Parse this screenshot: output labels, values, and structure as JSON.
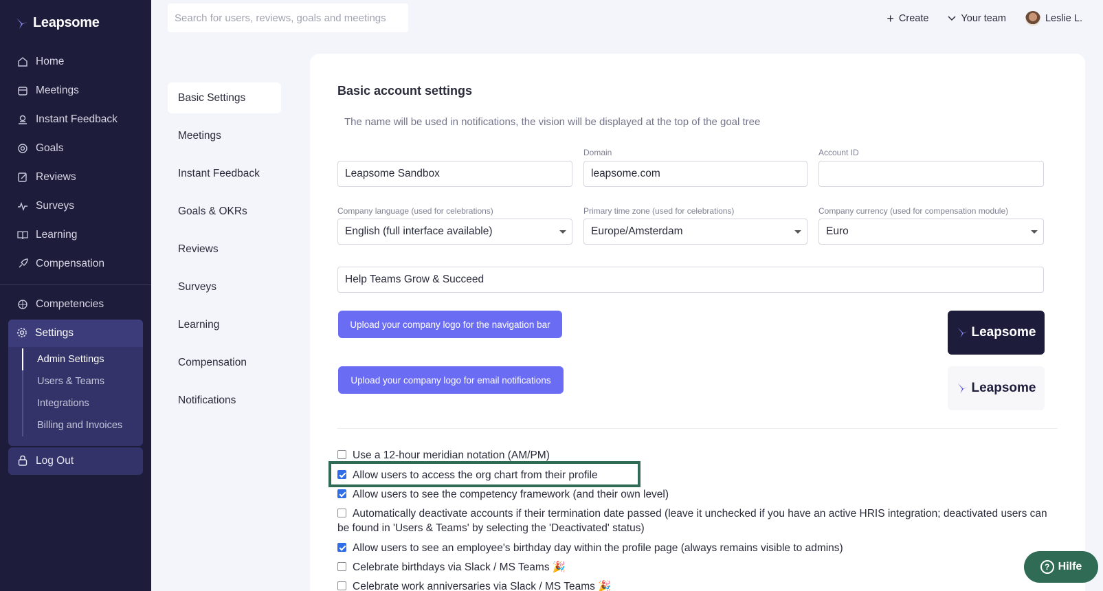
{
  "app": {
    "brand": "Leapsome",
    "accent": "#6b6cf4",
    "sidebar_bg": "#1d1c3b",
    "highlight_color": "#2f6b55"
  },
  "sidebar": {
    "items": [
      {
        "label": "Home",
        "icon": "home-icon"
      },
      {
        "label": "Meetings",
        "icon": "calendar-icon"
      },
      {
        "label": "Instant Feedback",
        "icon": "feedback-icon"
      },
      {
        "label": "Goals",
        "icon": "target-icon"
      },
      {
        "label": "Reviews",
        "icon": "review-icon"
      },
      {
        "label": "Surveys",
        "icon": "pulse-icon"
      },
      {
        "label": "Learning",
        "icon": "book-icon"
      },
      {
        "label": "Compensation",
        "icon": "rocket-icon"
      }
    ],
    "competencies": "Competencies",
    "settings": "Settings",
    "settings_sub": [
      "Admin Settings",
      "Users & Teams",
      "Integrations",
      "Billing and Invoices"
    ],
    "logout": "Log Out"
  },
  "topbar": {
    "search_placeholder": "Search for users, reviews, goals and meetings",
    "create": "Create",
    "your_team": "Your team",
    "user": "Leslie L."
  },
  "settings_menu": [
    "Basic Settings",
    "Meetings",
    "Instant Feedback",
    "Goals & OKRs",
    "Reviews",
    "Surveys",
    "Learning",
    "Compensation",
    "Notifications"
  ],
  "card": {
    "title": "Basic account settings",
    "description": "The name will be used in notifications, the vision will be displayed at the top of the goal tree",
    "company_name": "Leapsome Sandbox",
    "domain_label": "Domain",
    "domain": "leapsome.com",
    "account_id_label": "Account ID",
    "account_id": "",
    "language_label": "Company language (used for celebrations)",
    "language": "English (full interface available)",
    "timezone_label": "Primary time zone (used for celebrations)",
    "timezone": "Europe/Amsterdam",
    "currency_label": "Company currency (used for compensation module)",
    "currency": "Euro",
    "vision": "Help Teams Grow & Succeed",
    "upload_nav_logo": "Upload your company logo for the navigation bar",
    "upload_email_logo": "Upload your company logo for email notifications",
    "checkboxes": [
      {
        "label": "Use a 12-hour meridian notation (AM/PM)",
        "checked": false
      },
      {
        "label": "Allow users to access the org chart from their profile",
        "checked": true
      },
      {
        "label": "Allow users to see the competency framework (and their own level)",
        "checked": true
      },
      {
        "label": "Automatically deactivate accounts if their termination date passed (leave it unchecked if you have an active HRIS integration; deactivated users can be found in 'Users & Teams' by selecting the 'Deactivated' status)",
        "checked": false
      },
      {
        "label": "Allow users to see an employee's birthday day within the profile page (always remains visible to admins)",
        "checked": true
      },
      {
        "label": "Celebrate birthdays via Slack / MS Teams 🎉",
        "checked": false
      },
      {
        "label": "Celebrate work anniversaries via Slack / MS Teams 🎉",
        "checked": false
      }
    ]
  },
  "help": "Hilfe"
}
